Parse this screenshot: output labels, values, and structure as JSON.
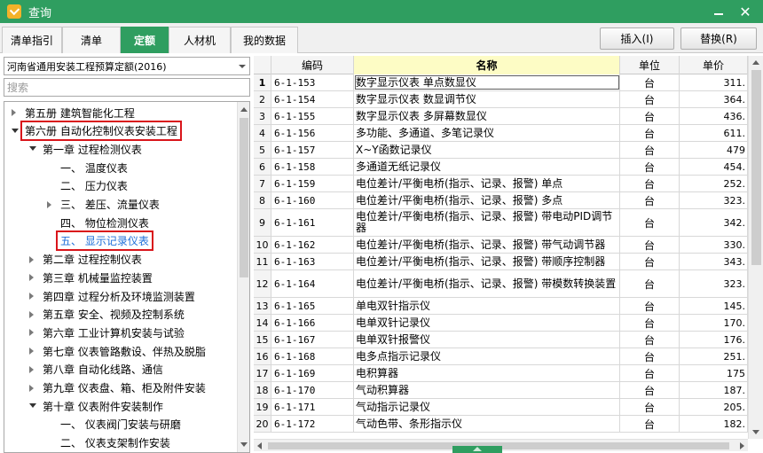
{
  "window": {
    "title": "查询"
  },
  "tabs": [
    {
      "label": "清单指引"
    },
    {
      "label": "清单"
    },
    {
      "label": "定额"
    },
    {
      "label": "人材机"
    },
    {
      "label": "我的数据"
    }
  ],
  "active_tab": "定额",
  "toolbar": {
    "insert_label": "插入(I)",
    "replace_label": "替换(R)"
  },
  "left": {
    "quota_library": "河南省通用安装工程预算定额(2016)",
    "search_placeholder": "搜索",
    "tree": [
      {
        "label": "第五册 建筑智能化工程",
        "level": 0,
        "toggle": "closed"
      },
      {
        "label": "第六册 自动化控制仪表安装工程",
        "level": 0,
        "toggle": "open",
        "highlight": true
      },
      {
        "label": "第一章 过程检测仪表",
        "level": 1,
        "toggle": "open"
      },
      {
        "label": "一、 温度仪表",
        "level": 2,
        "toggle": "none"
      },
      {
        "label": "二、 压力仪表",
        "level": 2,
        "toggle": "none"
      },
      {
        "label": "三、 差压、流量仪表",
        "level": 2,
        "toggle": "closed"
      },
      {
        "label": "四、 物位检测仪表",
        "level": 2,
        "toggle": "none"
      },
      {
        "label": "五、 显示记录仪表",
        "level": 2,
        "toggle": "none",
        "highlight": true,
        "selected": true
      },
      {
        "label": "第二章 过程控制仪表",
        "level": 1,
        "toggle": "closed"
      },
      {
        "label": "第三章 机械量监控装置",
        "level": 1,
        "toggle": "closed"
      },
      {
        "label": "第四章 过程分析及环境监测装置",
        "level": 1,
        "toggle": "closed"
      },
      {
        "label": "第五章 安全、视频及控制系统",
        "level": 1,
        "toggle": "closed"
      },
      {
        "label": "第六章 工业计算机安装与试验",
        "level": 1,
        "toggle": "closed"
      },
      {
        "label": "第七章 仪表管路敷设、伴热及脱脂",
        "level": 1,
        "toggle": "closed"
      },
      {
        "label": "第八章 自动化线路、通信",
        "level": 1,
        "toggle": "closed"
      },
      {
        "label": "第九章 仪表盘、箱、柜及附件安装",
        "level": 1,
        "toggle": "closed"
      },
      {
        "label": "第十章 仪表附件安装制作",
        "level": 1,
        "toggle": "open"
      },
      {
        "label": "一、 仪表阀门安装与研磨",
        "level": 2,
        "toggle": "none"
      },
      {
        "label": "二、 仪表支架制作安装",
        "level": 2,
        "toggle": "none"
      }
    ]
  },
  "grid": {
    "headers": {
      "code": "编码",
      "name": "名称",
      "unit": "单位",
      "price": "单价"
    },
    "rows": [
      {
        "idx": "1",
        "code": "6-1-153",
        "name": "数字显示仪表 单点数显仪",
        "unit": "台",
        "price": "311.",
        "tall": false,
        "selected": true
      },
      {
        "idx": "2",
        "code": "6-1-154",
        "name": "数字显示仪表 数显调节仪",
        "unit": "台",
        "price": "364.",
        "tall": false
      },
      {
        "idx": "3",
        "code": "6-1-155",
        "name": "数字显示仪表 多屏幕数显仪",
        "unit": "台",
        "price": "436.",
        "tall": false
      },
      {
        "idx": "4",
        "code": "6-1-156",
        "name": "多功能、多通道、多笔记录仪",
        "unit": "台",
        "price": "611.",
        "tall": false
      },
      {
        "idx": "5",
        "code": "6-1-157",
        "name": "X~Y函数记录仪",
        "unit": "台",
        "price": "479",
        "tall": false
      },
      {
        "idx": "6",
        "code": "6-1-158",
        "name": "多通道无纸记录仪",
        "unit": "台",
        "price": "454.",
        "tall": false
      },
      {
        "idx": "7",
        "code": "6-1-159",
        "name": "电位差计/平衡电桥(指示、记录、报警) 单点",
        "unit": "台",
        "price": "252.",
        "tall": false
      },
      {
        "idx": "8",
        "code": "6-1-160",
        "name": "电位差计/平衡电桥(指示、记录、报警) 多点",
        "unit": "台",
        "price": "323.",
        "tall": false
      },
      {
        "idx": "9",
        "code": "6-1-161",
        "name": "电位差计/平衡电桥(指示、记录、报警) 带电动PID调节器",
        "unit": "台",
        "price": "342.",
        "tall": true
      },
      {
        "idx": "10",
        "code": "6-1-162",
        "name": "电位差计/平衡电桥(指示、记录、报警) 带气动调节器",
        "unit": "台",
        "price": "330.",
        "tall": false
      },
      {
        "idx": "11",
        "code": "6-1-163",
        "name": "电位差计/平衡电桥(指示、记录、报警) 带顺序控制器",
        "unit": "台",
        "price": "343.",
        "tall": false
      },
      {
        "idx": "12",
        "code": "6-1-164",
        "name": "电位差计/平衡电桥(指示、记录、报警) 带模数转换装置",
        "unit": "台",
        "price": "323.",
        "tall": true
      },
      {
        "idx": "13",
        "code": "6-1-165",
        "name": "单电双针指示仪",
        "unit": "台",
        "price": "145.",
        "tall": false
      },
      {
        "idx": "14",
        "code": "6-1-166",
        "name": "电单双针记录仪",
        "unit": "台",
        "price": "170.",
        "tall": false
      },
      {
        "idx": "15",
        "code": "6-1-167",
        "name": "电单双针报警仪",
        "unit": "台",
        "price": "176.",
        "tall": false
      },
      {
        "idx": "16",
        "code": "6-1-168",
        "name": "电多点指示记录仪",
        "unit": "台",
        "price": "251.",
        "tall": false
      },
      {
        "idx": "17",
        "code": "6-1-169",
        "name": "电积算器",
        "unit": "台",
        "price": "175",
        "tall": false
      },
      {
        "idx": "18",
        "code": "6-1-170",
        "name": "气动积算器",
        "unit": "台",
        "price": "187.",
        "tall": false
      },
      {
        "idx": "19",
        "code": "6-1-171",
        "name": "气动指示记录仪",
        "unit": "台",
        "price": "205.",
        "tall": false
      },
      {
        "idx": "20",
        "code": "6-1-172",
        "name": "气动色带、条形指示仪",
        "unit": "台",
        "price": "182.",
        "tall": false
      }
    ]
  },
  "colors": {
    "accent_green": "#2f9e60",
    "highlight_red": "#d9151b",
    "name_header_yellow": "#fdfcc5",
    "selected_tree_text": "#1e6fd9"
  }
}
